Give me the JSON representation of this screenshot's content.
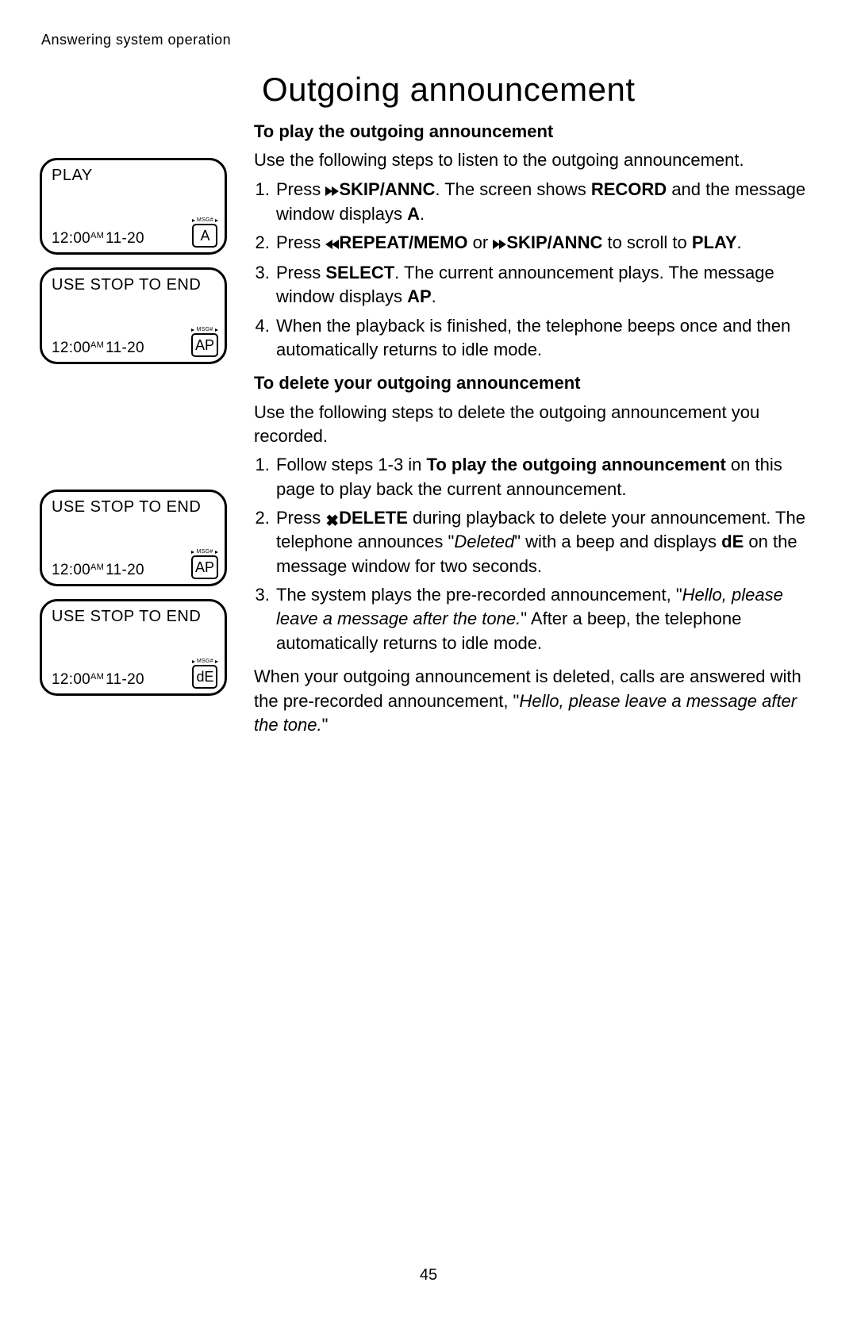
{
  "header": "Answering system operation",
  "title": "Outgoing announcement",
  "page_number": "45",
  "lcd": {
    "msg_label": "MSG#",
    "screens": [
      {
        "top": "PLAY",
        "time": "12:00",
        "ampm": "AM",
        "date": "11-20",
        "code": "A"
      },
      {
        "top": "USE STOP TO END",
        "time": "12:00",
        "ampm": "AM",
        "date": "11-20",
        "code": "AP"
      },
      {
        "top": "USE STOP TO END",
        "time": "12:00",
        "ampm": "AM",
        "date": "11-20",
        "code": "AP"
      },
      {
        "top": "USE STOP TO END",
        "time": "12:00",
        "ampm": "AM",
        "date": "11-20",
        "code": "dE"
      }
    ]
  },
  "play": {
    "heading": "To play the outgoing announcement",
    "intro": "Use the following steps to listen to the outgoing announcement.",
    "s1_a": "Press ",
    "s1_b": "SKIP",
    "s1_c": "/ANNC",
    "s1_d": ". The screen shows ",
    "s1_e": "RECORD",
    "s1_f": " and the message window displays ",
    "s1_g": "A",
    "s1_h": ".",
    "s2_a": "Press ",
    "s2_b": "REPEAT/",
    "s2_c": "MEMO",
    "s2_d": " or ",
    "s2_e": "SKIP/",
    "s2_f": "ANNC",
    "s2_g": " to scroll to ",
    "s2_h": "PLAY",
    "s2_i": ".",
    "s3_a": "Press ",
    "s3_b": "SELECT",
    "s3_c": ". The current announcement plays. The message window displays ",
    "s3_d": "AP",
    "s3_e": ".",
    "s4": "When the playback is finished, the telephone beeps once and then automatically returns to idle mode."
  },
  "del": {
    "heading": "To delete your outgoing announcement",
    "intro": "Use the following steps to delete the outgoing announcement you recorded.",
    "s1_a": "Follow steps 1-3 in ",
    "s1_b": "To play the outgoing announcement",
    "s1_c": " on this page to play back the current announcement.",
    "s2_a": "Press ",
    "s2_b": "DELETE",
    "s2_c": " during playback to delete your announcement. The telephone announces \"",
    "s2_d": "Deleted",
    "s2_e": "\" with a beep and displays ",
    "s2_f": "dE",
    "s2_g": " on the message window for two seconds.",
    "s3_a": "The system plays the pre-recorded announcement, \"",
    "s3_b": "Hello, please leave a message after the tone.",
    "s3_c": "\" After a beep, the telephone automatically returns to idle mode.",
    "out_a": "When your outgoing announcement is deleted, calls are answered with the pre-recorded announcement, \"",
    "out_b": "Hello, please leave a message after the tone.",
    "out_c": "\""
  }
}
